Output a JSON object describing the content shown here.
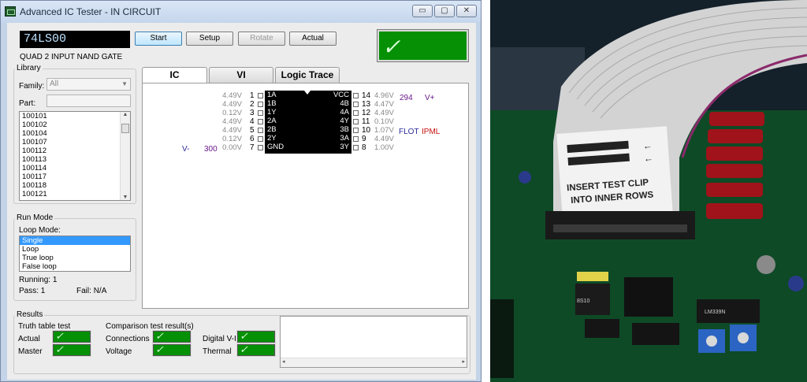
{
  "window": {
    "title": "Advanced IC Tester - IN CIRCUIT",
    "min": "▭",
    "max": "▢",
    "close": "✕"
  },
  "device": {
    "part": "74LS00",
    "description": "QUAD 2 INPUT NAND GATE"
  },
  "toolbar": {
    "start": "Start",
    "setup": "Setup",
    "rotate": "Rotate",
    "actual": "Actual"
  },
  "status_check": "✓",
  "library": {
    "title": "Library",
    "family_label": "Family:",
    "family_value": "All",
    "part_label": "Part:",
    "part_value": "",
    "parts": [
      "100101",
      "100102",
      "100104",
      "100107",
      "100112",
      "100113",
      "100114",
      "100117",
      "100118",
      "100121"
    ]
  },
  "run_mode": {
    "title": "Run Mode",
    "loop_label": "Loop Mode:",
    "modes": [
      "Single",
      "Loop",
      "True loop",
      "False loop"
    ],
    "selected": "Single",
    "running_label": "Running:",
    "running_value": "1",
    "pass_label": "Pass:",
    "pass_value": "1",
    "fail_label": "Fail:",
    "fail_value": "N/A"
  },
  "tabs": [
    {
      "label": "IC"
    },
    {
      "label": "VI"
    },
    {
      "label": "Logic Trace"
    }
  ],
  "ic_view": {
    "left_pins": [
      {
        "num": "1",
        "volt": "4.49V",
        "name": "1A"
      },
      {
        "num": "2",
        "volt": "4.49V",
        "name": "1B"
      },
      {
        "num": "3",
        "volt": "0.12V",
        "name": "1Y"
      },
      {
        "num": "4",
        "volt": "4.49V",
        "name": "2A"
      },
      {
        "num": "5",
        "volt": "4.49V",
        "name": "2B"
      },
      {
        "num": "6",
        "volt": "0.12V",
        "name": "2Y"
      },
      {
        "num": "7",
        "volt": "0.00V",
        "name": "GND"
      }
    ],
    "right_pins": [
      {
        "num": "14",
        "volt": "4.96V",
        "name": "VCC"
      },
      {
        "num": "13",
        "volt": "4.47V",
        "name": "4B"
      },
      {
        "num": "12",
        "volt": "4.49V",
        "name": "4A"
      },
      {
        "num": "11",
        "volt": "0.10V",
        "name": "4Y"
      },
      {
        "num": "10",
        "volt": "1.07V",
        "name": "3B"
      },
      {
        "num": "9",
        "volt": "4.49V",
        "name": "3A"
      },
      {
        "num": "8",
        "volt": "1.00V",
        "name": "3Y"
      }
    ],
    "vplus_value": "294",
    "vplus_label": "V+",
    "vminus_label": "V-",
    "vminus_value": "300",
    "flot_label": "FLOT",
    "ipml_label": "IPML"
  },
  "results": {
    "title": "Results",
    "truth_title": "Truth table test",
    "actual_label": "Actual",
    "master_label": "Master",
    "comparison_title": "Comparison test result(s)",
    "connections_label": "Connections",
    "voltage_label": "Voltage",
    "digital_vi_label": "Digital V-I",
    "thermal_label": "Thermal",
    "scroll_left": "◂",
    "scroll_right": "▸"
  },
  "photo": {
    "label_line1": "INSERT TEST CLIP",
    "label_line2": "INTO INNER ROWS",
    "chip_a": "8S10",
    "chip_b": "LM339N",
    "colors": {
      "board": "#0e4a26",
      "cable": "#d3d3d3",
      "resistor": "#a0131a",
      "pot": "#2b64c2"
    }
  },
  "colors": {
    "pass_green": "#069006",
    "accent_blue": "#3399ff",
    "lcd_text": "#bfe2ff"
  }
}
